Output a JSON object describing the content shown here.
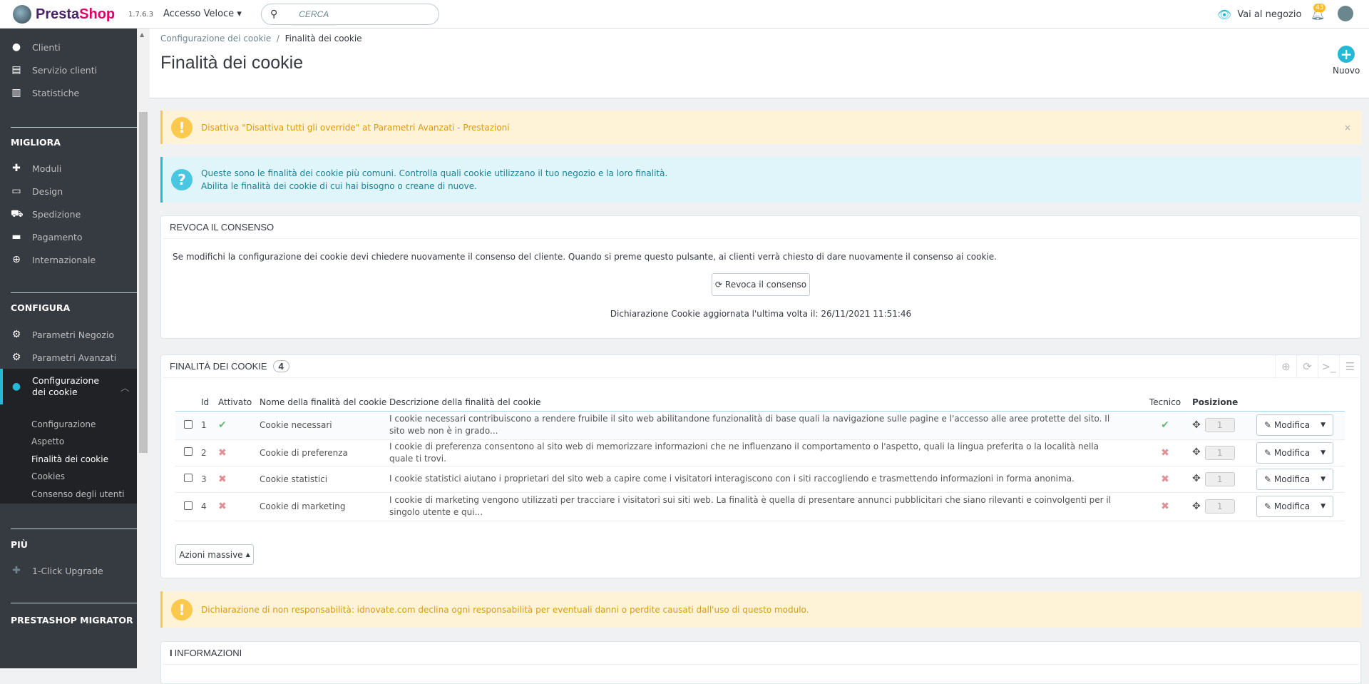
{
  "header": {
    "logo": "PrestaShop",
    "version": "1.7.6.3",
    "quick_access": "Accesso Veloce",
    "search_placeholder": "Cerca",
    "view_shop": "Vai al negozio",
    "notifications": "43"
  },
  "sidebar": {
    "items_top": [
      "Clienti",
      "Servizio clienti",
      "Statistiche"
    ],
    "sections": {
      "improve": "MIGLIORA",
      "configure": "CONFIGURA",
      "more": "PIÙ",
      "migrator": "PRESTASHOP MIGRATOR"
    },
    "improve_items": [
      "Moduli",
      "Design",
      "Spedizione",
      "Pagamento",
      "Internazionale"
    ],
    "configure_items": [
      "Parametri Negozio",
      "Parametri Avanzati"
    ],
    "active": "Configurazione dei cookie",
    "sub_items": [
      "Configurazione",
      "Aspetto",
      "Finalità dei cookie",
      "Cookies",
      "Consenso degli utenti"
    ],
    "more_items": [
      "1-Click Upgrade"
    ]
  },
  "page": {
    "breadcrumb_parent": "Configurazione dei cookie",
    "breadcrumb_current": "Finalità dei cookie",
    "title": "Finalità dei cookie",
    "new_label": "Nuovo"
  },
  "alerts": {
    "warning": "Disattiva \"Disattiva tutti gli override\" at Parametri Avanzati - Prestazioni",
    "info_line1": "Queste sono le finalità dei cookie più comuni. Controlla quali cookie utilizzano il tuo negozio e la loro finalità.",
    "info_line2": "Abilita le finalità dei cookie di cui hai bisogno o creane di nuove.",
    "disclaimer": "Dichiarazione di non responsabilità: idnovate.com declina ogni responsabilità per eventuali danni o perdite causati dall'uso di questo modulo."
  },
  "revoke": {
    "title": "REVOCA IL CONSENSO",
    "text": "Se modifichi la configurazione dei cookie devi chiedere nuovamente il consenso del cliente. Quando si preme questo pulsante, ai clienti verrà chiesto di dare nuovamente il consenso ai cookie.",
    "button": "Revoca il consenso",
    "updated": "Dichiarazione Cookie aggiornata l'ultima volta il: 26/11/2021 11:51:46"
  },
  "list": {
    "title": "FINALITÀ DEI COOKIE",
    "count": "4",
    "columns": [
      "Id",
      "Attivato",
      "Nome della finalità del cookie",
      "Descrizione della finalità del cookie",
      "Tecnico",
      "Posizione"
    ],
    "rows": [
      {
        "id": "1",
        "active": true,
        "name": "Cookie necessari",
        "desc": "I cookie necessari contribuiscono a rendere fruibile il sito web abilitandone funzionalità di base quali la navigazione sulle pagine e l'accesso alle aree protette del sito. Il sito web non è in grado...",
        "technical": true,
        "position": "1",
        "action": "Modifica"
      },
      {
        "id": "2",
        "active": false,
        "name": "Cookie di preferenza",
        "desc": "I cookie di preferenza consentono al sito web di memorizzare informazioni che ne influenzano il comportamento o l'aspetto, quali la lingua preferita o la località nella quale ti trovi.",
        "technical": false,
        "position": "1",
        "action": "Modifica"
      },
      {
        "id": "3",
        "active": false,
        "name": "Cookie statistici",
        "desc": "I cookie statistici aiutano i proprietari del sito web a capire come i visitatori interagiscono con i siti raccogliendo e trasmettendo informazioni in forma anonima.",
        "technical": false,
        "position": "1",
        "action": "Modifica"
      },
      {
        "id": "4",
        "active": false,
        "name": "Cookie di marketing",
        "desc": "I cookie di marketing vengono utilizzati per tracciare i visitatori sui siti web. La finalità è quella di presentare annunci pubblicitari che siano rilevanti e coinvolgenti per il singolo utente e qui...",
        "technical": false,
        "position": "1",
        "action": "Modifica"
      }
    ],
    "bulk": "Azioni massive"
  },
  "info_panel": {
    "title": "INFORMAZIONI"
  }
}
